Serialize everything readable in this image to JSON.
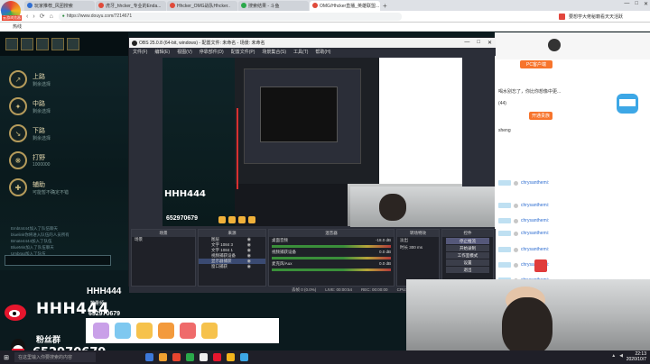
{
  "browser": {
    "brand_badge": "云游浏览器",
    "tabs": [
      {
        "label": "玩家推荐_风团搜索",
        "active": false
      },
      {
        "label": "虎牙_hhcker_专业的Enda...",
        "active": false
      },
      {
        "label": "Hhcker_OMG战队Hhcker..",
        "active": false
      },
      {
        "label": "搜索结果 - 斗鱼",
        "active": false
      },
      {
        "label": "OMG/Hhcker直播_英雄联盟...",
        "active": true
      }
    ],
    "new_tab": "+",
    "url": "https://www.douyu.com/7214671",
    "ext_text": "要想学大佬秘籍看天天活跃",
    "bookmark": "热线",
    "window_controls": [
      "—",
      "□",
      "✕"
    ]
  },
  "game": {
    "roles": [
      {
        "name": "上路",
        "sub": "剩余选择",
        "icon": "↗"
      },
      {
        "name": "中路",
        "sub": "剩余选择",
        "icon": "✦"
      },
      {
        "name": "下路",
        "sub": "剩余选择",
        "icon": "↘"
      },
      {
        "name": "打野",
        "sub": "1000000",
        "icon": "❋"
      },
      {
        "name": "辅助",
        "sub": "可能暂不确定不错",
        "icon": "✚"
      }
    ],
    "chat_lines": [
      "Embt4444加入了队伍聊天",
      "bluelink你将进入队伍的人员所有",
      "Bmate4444加入了队伍",
      "BlueMin加入了队伍聊天",
      "Umbrao加入了队伍"
    ]
  },
  "overlay": {
    "logo_text": "HHH444",
    "logo_sub": "数量频",
    "second_logo": "HHH444",
    "fans_label": "粉丝群",
    "fans_number": "652970679",
    "preview_number": "652970679"
  },
  "obs": {
    "title": "OBS 25.0.8 (64-bit, windows) - 配置文件: 未命名 - 场景: 未命名",
    "menu": [
      "文件(F)",
      "编辑(E)",
      "视图(V)",
      "停靠部件(D)",
      "配置文件(P)",
      "场景集合(S)",
      "工具(T)",
      "帮助(H)"
    ],
    "docks": {
      "scenes": "场景",
      "sources": "来源",
      "mixer": "混音器",
      "transitions": "转场特效",
      "controls": "控件"
    },
    "scene_item": "场景",
    "sources": [
      {
        "label": "图层",
        "selected": false
      },
      {
        "label": "文字 1084 3",
        "selected": false
      },
      {
        "label": "文字 1084 1",
        "selected": false
      },
      {
        "label": "视频捕获设备",
        "selected": false
      },
      {
        "label": "显示器捕获",
        "selected": true
      },
      {
        "label": "窗口捕获",
        "selected": false
      }
    ],
    "mixer": [
      {
        "label": "桌面音频",
        "db": "-18.0 dB"
      },
      {
        "label": "视频捕获设备",
        "db": "0.0 dB"
      },
      {
        "label": "麦克风/Aux",
        "db": "0.0 dB"
      }
    ],
    "transition": {
      "mode": "淡出",
      "duration_label": "时长",
      "duration": "300 ms"
    },
    "controls": [
      "停止推流",
      "开始录制",
      "工作室模式",
      "设置",
      "退出"
    ],
    "status": [
      "丢帧 0 (0.0%)",
      "LIVE: 00:00:54",
      "REC: 00:00:00",
      "CPU: 1.6%, 30.00 fps",
      "kb/s: 3993"
    ]
  },
  "douyu": {
    "pc_button": "PC客户端",
    "notice": "喝水别忘了，你比你想像中更...",
    "fan_count": "(44)",
    "fan_button": "开通贵族",
    "sub_tag": "sheng",
    "chat_users": [
      "chrysanthemi:",
      "chrysanthemi:",
      "chrysanthemi:",
      "chrysanthemi:",
      "chrysanthemi:",
      "chrysanthemi:",
      "chrysanthemi:",
      "chrysanthemi:"
    ]
  },
  "taskbar": {
    "search_placeholder": "在这里输入你要搜索的内容",
    "time": "22:13",
    "date": "2020/10/7"
  },
  "colors": {
    "douyu_orange": "#f7742c",
    "obs_dark": "#2b2e38",
    "chat_blue": "#2f6ed1"
  }
}
